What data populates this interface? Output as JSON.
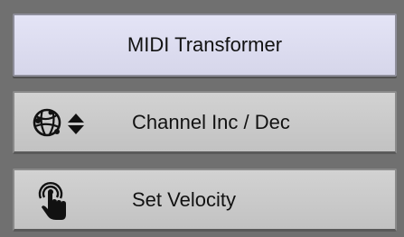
{
  "title": {
    "label": "MIDI Transformer"
  },
  "items": [
    {
      "label": "Channel Inc / Dec",
      "icon": "globe-updown-icon"
    },
    {
      "label": "Set Velocity",
      "icon": "touch-icon"
    }
  ],
  "colors": {
    "background": "#707070",
    "title_button": "#dcdcf0",
    "item_button": "#c8c8c8",
    "text": "#121212"
  }
}
